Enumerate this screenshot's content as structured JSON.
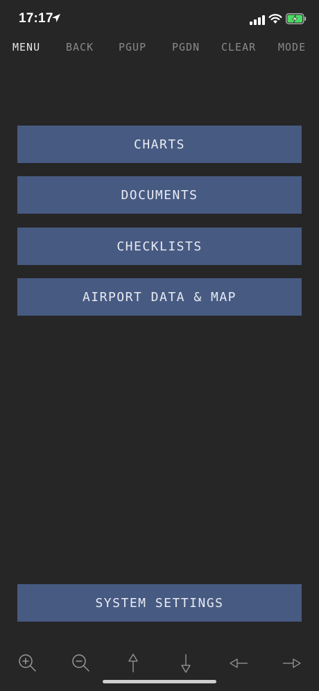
{
  "status_bar": {
    "time": "17:17",
    "icons": [
      "location-arrow-icon",
      "cellular-signal-icon",
      "wifi-icon",
      "battery-charging-icon"
    ],
    "battery_color": "#4cd964"
  },
  "command_bar": {
    "menu": "MENU",
    "back": "BACK",
    "pgup": "PGUP",
    "pgdn": "PGDN",
    "clear": "CLEAR",
    "mode": "MODE"
  },
  "menu": {
    "charts": "CHARTS",
    "documents": "DOCUMENTS",
    "checklists": "CHECKLISTS",
    "airport": "AIRPORT DATA & MAP"
  },
  "footer": {
    "system_settings": "SYSTEM SETTINGS"
  },
  "toolbar": {
    "icons": [
      "zoom-in-icon",
      "zoom-out-icon",
      "arrow-up-icon",
      "arrow-down-icon",
      "arrow-left-icon",
      "arrow-right-icon"
    ]
  },
  "colors": {
    "background": "#262626",
    "button": "#475a82",
    "button_text": "#e8ebf2",
    "command_inactive": "#8a8a8a",
    "command_active": "#e6e6e6"
  }
}
